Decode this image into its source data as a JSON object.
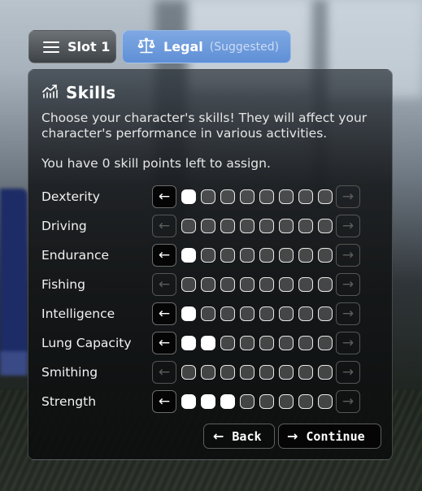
{
  "tabs": {
    "slot": {
      "label": "Slot 1",
      "icon": "menu-icon"
    },
    "legal": {
      "label": "Legal",
      "sublabel": "(Suggested)",
      "icon": "scales-icon"
    }
  },
  "panel": {
    "icon": "chart-icon",
    "title": "Skills",
    "description": "Choose your character's skills! They will affect your character's performance in various activities.",
    "points_text": "You have 0 skill points left to assign.",
    "points_left": 0,
    "max_level": 8
  },
  "skills": [
    {
      "name": "Dexterity",
      "level": 1
    },
    {
      "name": "Driving",
      "level": 0
    },
    {
      "name": "Endurance",
      "level": 1
    },
    {
      "name": "Fishing",
      "level": 0
    },
    {
      "name": "Intelligence",
      "level": 1
    },
    {
      "name": "Lung Capacity",
      "level": 2
    },
    {
      "name": "Smithing",
      "level": 0
    },
    {
      "name": "Strength",
      "level": 3
    }
  ],
  "icons": {
    "decrease": "←",
    "increase": "→"
  },
  "footer": {
    "back_label": "Back",
    "continue_label": "Continue",
    "back_icon": "←",
    "continue_icon": "→"
  },
  "colors": {
    "legal_tab": "#6d9bdc",
    "slot_tab": "#55595d",
    "pip_filled": "#ffffff"
  }
}
